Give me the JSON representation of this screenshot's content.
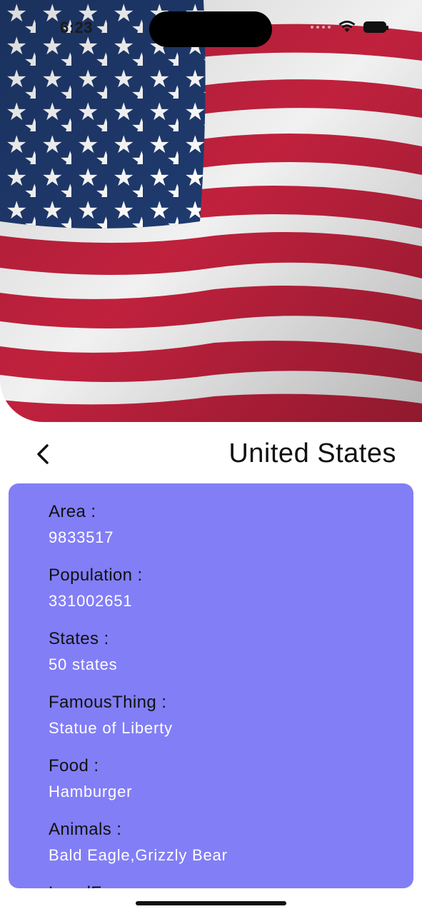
{
  "status_bar": {
    "time": "6:23",
    "icons": [
      "signal-icon",
      "wifi-icon",
      "battery-icon"
    ]
  },
  "hero": {
    "image": "us-flag-image",
    "colors": {
      "blue": "#1f3a6e",
      "red": "#c0213d",
      "white": "#f1f1f1"
    }
  },
  "header": {
    "back_icon": "chevron-left-icon",
    "title": "United States"
  },
  "card": {
    "background": "#827ef6",
    "fields": [
      {
        "label": "Area :",
        "value": "9833517"
      },
      {
        "label": "Population :",
        "value": "331002651"
      },
      {
        "label": "States :",
        "value": "50 states"
      },
      {
        "label": "FamousThing :",
        "value": "Statue of Liberty"
      },
      {
        "label": "Food :",
        "value": "Hamburger"
      },
      {
        "label": "Animals :",
        "value": "Bald Eagle,Grizzly Bear"
      },
      {
        "label": "LocalF",
        "value": ""
      }
    ]
  }
}
